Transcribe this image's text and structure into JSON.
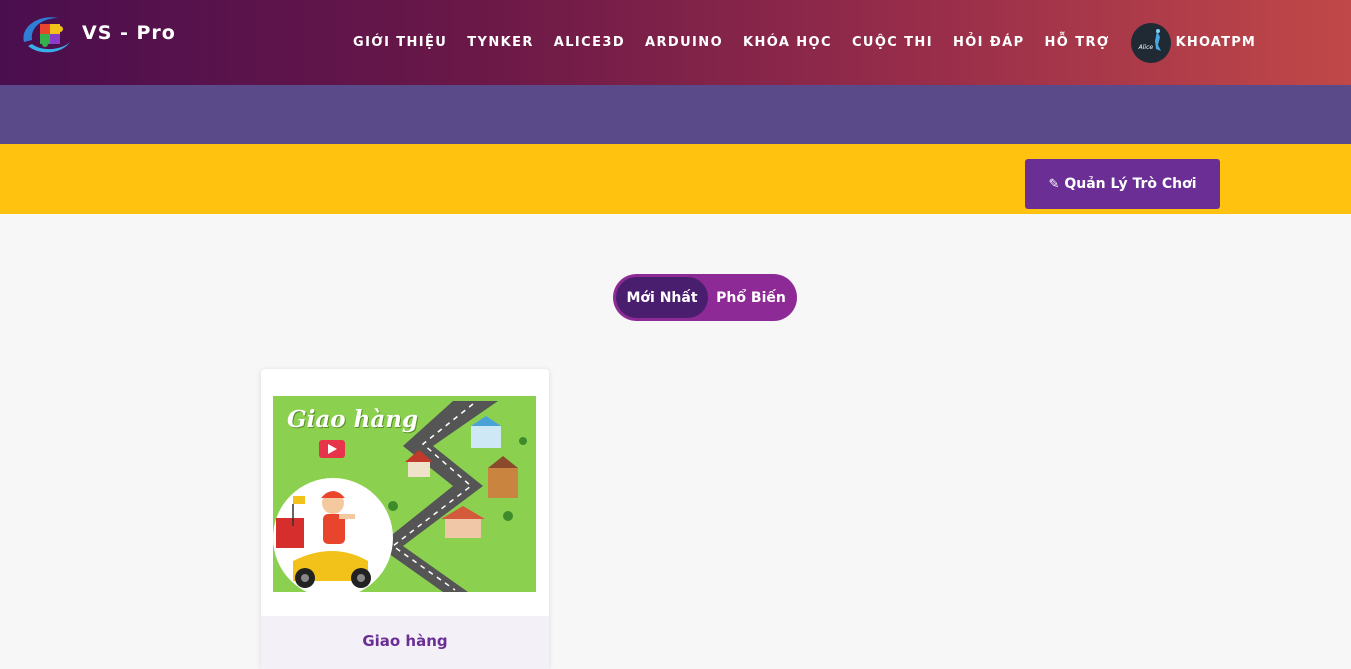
{
  "brand": {
    "name": "VS - Pro",
    "logo_icon": "puzzle-swoosh-logo"
  },
  "nav": {
    "items": [
      {
        "label": "GIỚI THIỆU"
      },
      {
        "label": "TYNKER"
      },
      {
        "label": "ALICE3D"
      },
      {
        "label": "ARDUINO"
      },
      {
        "label": "KHÓA HỌC"
      },
      {
        "label": "CUỘC THI"
      },
      {
        "label": "HỎI ĐÁP"
      },
      {
        "label": "HỖ TRỢ"
      }
    ],
    "user": {
      "name": "KHOATPM",
      "avatar_text": "Alice"
    }
  },
  "toolbar": {
    "manage_label": "Quản Lý Trò Chơi",
    "manage_icon": "edit-icon"
  },
  "filter": {
    "newest_label": "Mới Nhất",
    "popular_label": "Phổ Biến",
    "selected": "Mới Nhất"
  },
  "games": [
    {
      "title": "Giao hàng",
      "thumbnail_text": "Giao hàng"
    }
  ],
  "colors": {
    "purple_band": "#5b4a89",
    "yellow_band": "#ffc20e",
    "accent": "#6a2e95",
    "toggle_bg": "#8e2a95",
    "toggle_active": "#4a1e6e"
  }
}
